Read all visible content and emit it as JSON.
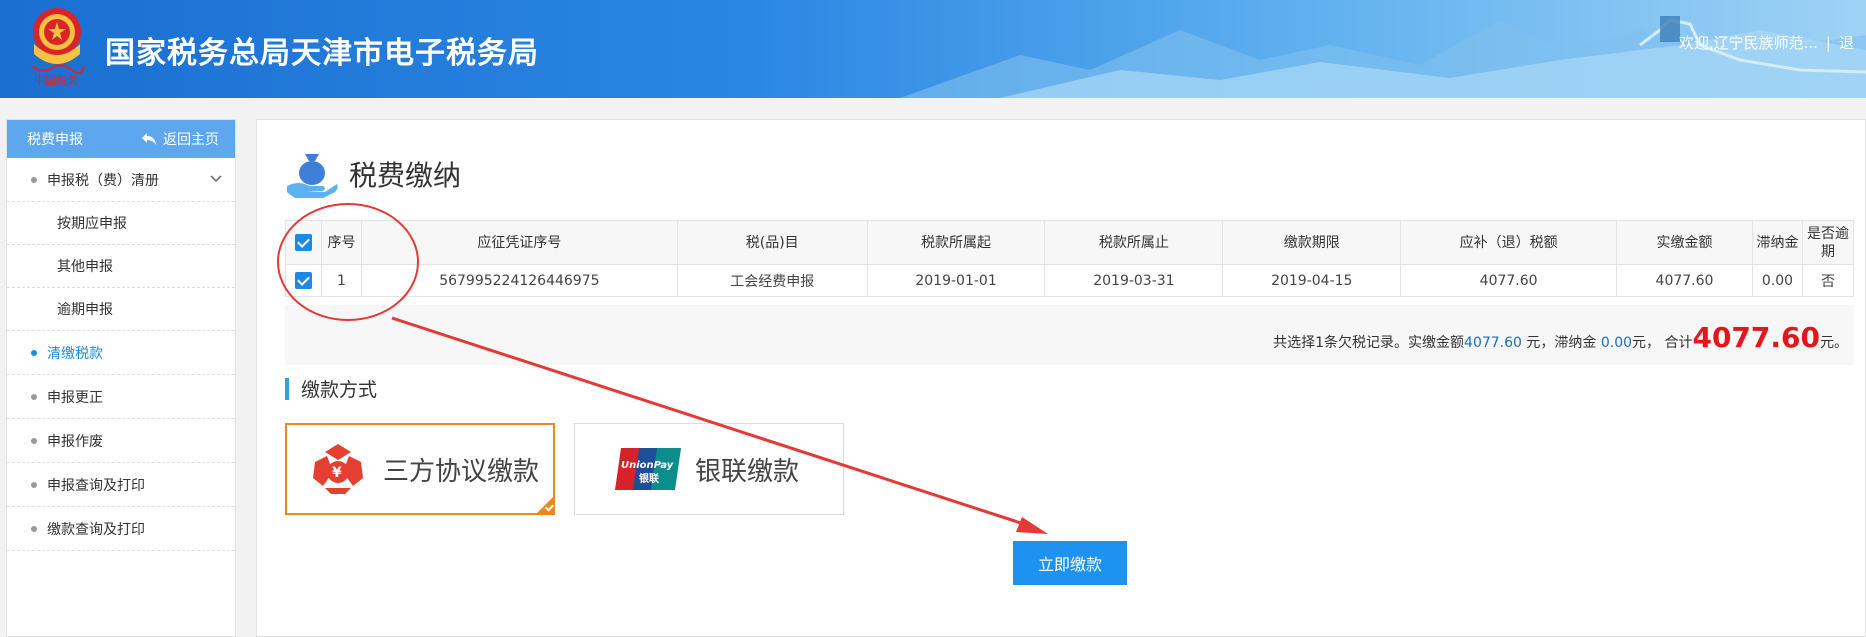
{
  "header": {
    "site_title": "国家税务总局天津市电子税务局",
    "welcome_text": "欢迎,辽宁民族师范...",
    "separator": "|",
    "logout_label": "退"
  },
  "sidebar": {
    "head_title": "税费申报",
    "back_home_label": "返回主页",
    "items": [
      {
        "label": "申报税（费）清册",
        "type": "group",
        "expanded": true
      },
      {
        "label": "按期应申报",
        "type": "sub"
      },
      {
        "label": "其他申报",
        "type": "sub"
      },
      {
        "label": "逾期申报",
        "type": "sub"
      },
      {
        "label": "清缴税款",
        "type": "item",
        "active": true
      },
      {
        "label": "申报更正",
        "type": "item"
      },
      {
        "label": "申报作废",
        "type": "item"
      },
      {
        "label": "申报查询及打印",
        "type": "item"
      },
      {
        "label": "缴款查询及打印",
        "type": "item"
      }
    ]
  },
  "main": {
    "page_title": "税费缴纳",
    "table": {
      "columns": [
        "序号",
        "应征凭证序号",
        "税(品)目",
        "税款所属起",
        "税款所属止",
        "缴款期限",
        "应补（退）税额",
        "实缴金额",
        "滞纳金",
        "是否逾期"
      ],
      "rows": [
        {
          "index": "1",
          "voucher": "567995224126446975",
          "item": "工会经费申报",
          "start": "2019-01-01",
          "end": "2019-03-31",
          "deadline": "2019-04-15",
          "due_amount": "4077.60",
          "paid_amount": "4077.60",
          "late_fee": "0.00",
          "overdue": "否"
        }
      ]
    },
    "summary": {
      "prefix": "共选择1条欠税记录。实缴金额",
      "paid_amount": "4077.60",
      "mid1": " 元，滞纳金 ",
      "late_fee": "0.00",
      "mid2": "元， 合计",
      "total": "4077.60",
      "suffix": "元。"
    },
    "payment_section_title": "缴款方式",
    "payment_options": [
      {
        "label": "三方协议缴款",
        "selected": true,
        "icon": "third-party-agreement-icon"
      },
      {
        "label": "银联缴款",
        "selected": false,
        "icon": "unionpay-icon",
        "logo_text_top": "UnionPay",
        "logo_text_bottom": "银联"
      }
    ],
    "pay_now_label": "立即缴款"
  },
  "colors": {
    "header_blue": "#1a6fd0",
    "sidebar_head": "#5ea7ee",
    "active_link": "#1a8ee8",
    "primary_button": "#1d92f0",
    "selected_border": "#e98a1c",
    "total_red": "#e4161c",
    "annotation_red": "#e53935"
  }
}
